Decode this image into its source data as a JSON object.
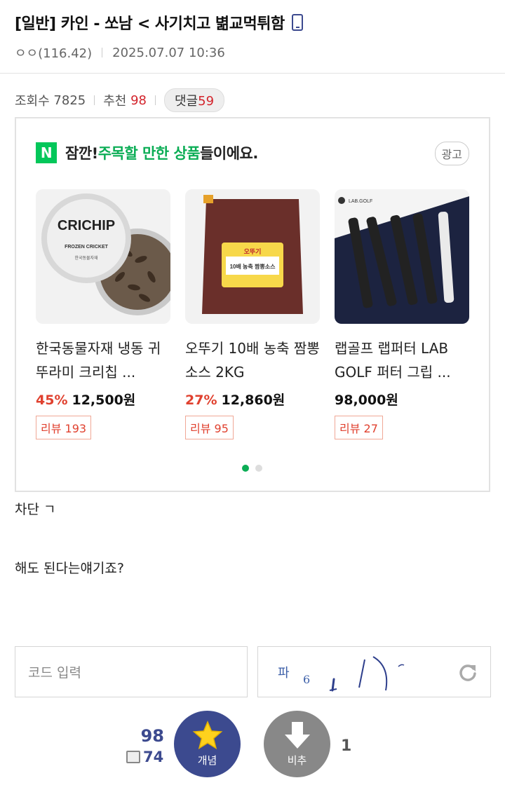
{
  "post": {
    "title": "[일반] 카인 - 쏘남 < 사기치고 볆교먹튀함",
    "author": "ㅇㅇ(116.42)",
    "date": "2025.07.07 10:36",
    "views_label": "조회수",
    "views": "7825",
    "recommend_label": "추천",
    "recommend": "98",
    "comments_label": "댓글",
    "comments": "59",
    "body_line1": "차단 ㄱ",
    "body_line2": "해도 된다는얘기죠?"
  },
  "ad": {
    "logo": "N",
    "heading_pre": "잠깐! ",
    "heading_highlight": "주목할 만한 상품",
    "heading_post": "들이에요.",
    "badge": "광고",
    "products": [
      {
        "name": "한국동물자재 냉동 귀뚜라미 크리칩 ...",
        "discount": "45%",
        "price": "12,500원",
        "review": "리뷰 193"
      },
      {
        "name": "오뚜기 10배 농축 짬뽕 소스 2KG",
        "discount": "27%",
        "price": "12,860원",
        "review": "리뷰 95"
      },
      {
        "name": "랩골프 랩퍼터 LAB GOLF 퍼터 그립 ...",
        "discount": "",
        "price": "98,000원",
        "review": "리뷰 27"
      }
    ],
    "page_index": 1,
    "page_count": 2
  },
  "captcha": {
    "placeholder": "코드 입력",
    "image_text": "파6 ɪ )˜"
  },
  "vote": {
    "up_count": "98",
    "fix_count": "74",
    "up_label": "개념",
    "down_label": "비추",
    "down_count": "1"
  },
  "colors": {
    "accent_navy": "#3c4a8f",
    "naver_green": "#03c75a",
    "discount_red": "#e0412f",
    "recommend_red": "#d3242c"
  }
}
